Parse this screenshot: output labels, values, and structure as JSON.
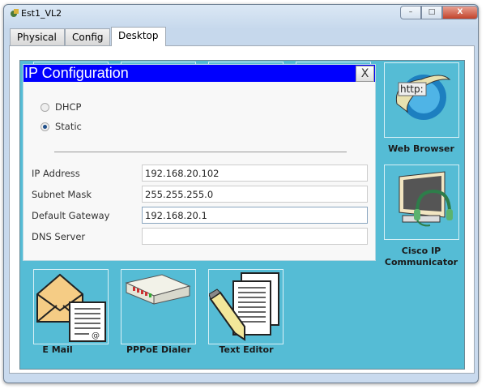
{
  "window": {
    "title": "Est1_VL2",
    "minimize": "–",
    "maximize": "□",
    "close": "X"
  },
  "tabs": [
    {
      "label": "Physical"
    },
    {
      "label": "Config"
    },
    {
      "label": "Desktop"
    }
  ],
  "dialog": {
    "title": "IP Configuration",
    "close": "X",
    "mode_options": [
      {
        "label": "DHCP",
        "selected": false
      },
      {
        "label": "Static",
        "selected": true
      }
    ],
    "fields": [
      {
        "label": "IP Address",
        "value": "192.168.20.102"
      },
      {
        "label": "Subnet Mask",
        "value": "255.255.255.0"
      },
      {
        "label": "Default Gateway",
        "value": "192.168.20.1"
      },
      {
        "label": "DNS Server",
        "value": ""
      }
    ]
  },
  "apps": {
    "web_browser": "Web Browser",
    "cisco_ip": "Cisco IP Communicator",
    "email": "E Mail",
    "pppoe": "PPPoE Dialer",
    "text_editor": "Text Editor"
  }
}
